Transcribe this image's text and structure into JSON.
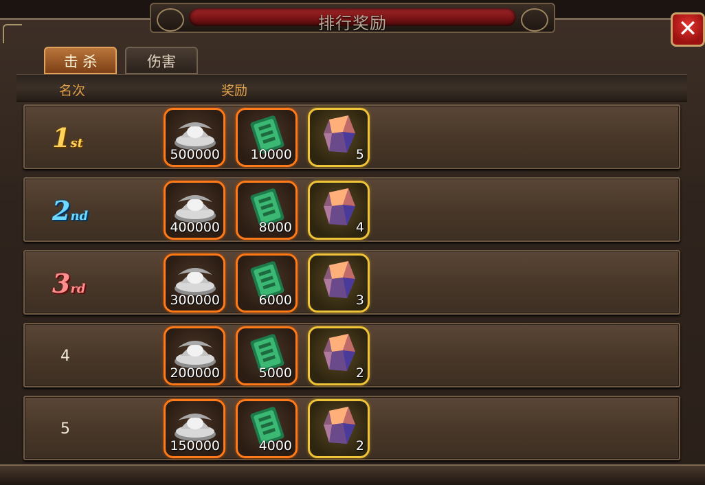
{
  "window": {
    "title": "排行奖励",
    "close_symbol": "✕"
  },
  "tabs": [
    {
      "label": "击 杀",
      "active": true
    },
    {
      "label": "伤害",
      "active": false
    }
  ],
  "table": {
    "headers": {
      "rank": "名次",
      "reward": "奖励"
    },
    "rows": [
      {
        "rank_num": "1",
        "rank_suffix": "st",
        "silver": "500000",
        "jade": "10000",
        "gem": "5"
      },
      {
        "rank_num": "2",
        "rank_suffix": "nd",
        "silver": "400000",
        "jade": "8000",
        "gem": "4"
      },
      {
        "rank_num": "3",
        "rank_suffix": "rd",
        "silver": "300000",
        "jade": "6000",
        "gem": "3"
      },
      {
        "rank_num": "4",
        "rank_suffix": "",
        "silver": "200000",
        "jade": "5000",
        "gem": "2"
      },
      {
        "rank_num": "5",
        "rank_suffix": "",
        "silver": "150000",
        "jade": "4000",
        "gem": "2"
      }
    ]
  },
  "icons": {
    "silver": "silver-ingot-icon",
    "jade": "jade-token-icon",
    "gem": "crystal-gem-icon",
    "close": "close-icon"
  },
  "colors": {
    "header_text": "#e2a24a",
    "rank1": "#ffd35a",
    "rank2": "#6fd9ff",
    "rank3": "#ff8f8f",
    "item_border_orange": "#ff7a1a",
    "item_border_gold": "#f0c43a"
  }
}
